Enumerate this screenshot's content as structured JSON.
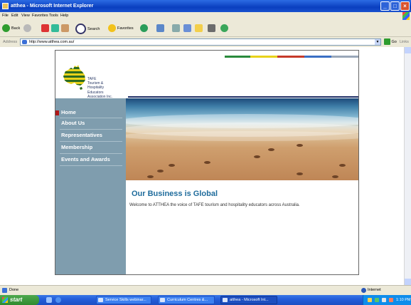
{
  "window": {
    "title": "atthea - Microsoft Internet Explorer",
    "controls": {
      "minimize": "_",
      "maximize": "□",
      "close": "×"
    }
  },
  "menu": [
    "File",
    "Edit",
    "View",
    "Favorites",
    "Tools",
    "Help"
  ],
  "toolbar": {
    "back_label": "Back",
    "search_label": "Search",
    "favorites_label": "Favorites"
  },
  "address_bar": {
    "label": "Address",
    "url": "http://www.atthea.com.au/",
    "go_label": "Go",
    "links_label": "Links"
  },
  "site": {
    "logo_text": [
      "TAFE",
      "Tourism &",
      "Hospitality",
      "Educators",
      "Association Inc."
    ],
    "logo_colors": {
      "gold": "#e8d21a",
      "green": "#2d6b20"
    },
    "strip_colors": [
      "#2a8a3c",
      "#e8d21a",
      "#c63a2a",
      "#3a6fc4",
      "#9aa7b8"
    ],
    "nav": [
      {
        "label": "Home",
        "active": true
      },
      {
        "label": "About Us",
        "active": false
      },
      {
        "label": "Representatives",
        "active": false
      },
      {
        "label": "Membership",
        "active": false
      },
      {
        "label": "Events and Awards",
        "active": false
      }
    ],
    "headline": "Our Business is Global",
    "welcome": "Welcome to ATTHEA the voice of TAFE tourism and hospitality educators across Australia."
  },
  "status_bar": {
    "status": "Done",
    "zone": "Internet"
  },
  "taskbar": {
    "start_label": "start",
    "tasks": [
      {
        "label": "Service Skills webinar...",
        "active": false
      },
      {
        "label": "Curriculum Centres &...",
        "active": false
      },
      {
        "label": "atthea - Microsoft Int...",
        "active": true
      }
    ],
    "clock": "1:10 PM"
  }
}
